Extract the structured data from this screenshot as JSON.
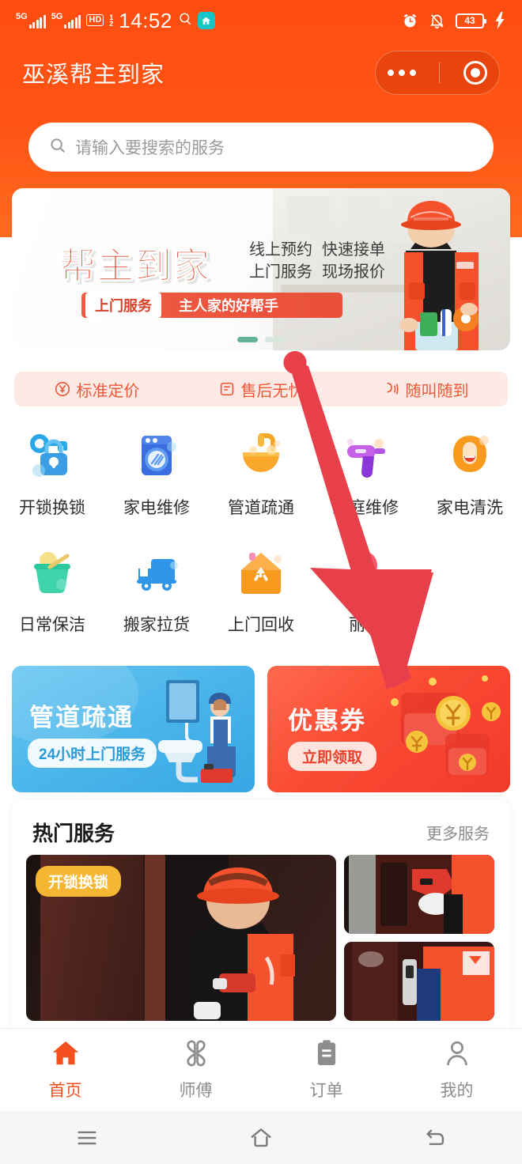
{
  "status_bar": {
    "network_1": "5G",
    "network_2": "5G",
    "hd": "HD",
    "sim_top": "1",
    "sim_bottom": "2",
    "time": "14:52",
    "message_icon": "message-icon",
    "home_chip_icon": "home-chip-icon",
    "alarm_icon": "alarm-icon",
    "mute_icon": "bell-muted-icon",
    "battery_level": "43",
    "charging_icon": "charging-bolt-icon"
  },
  "header": {
    "title": "巫溪帮主到家",
    "capsule": {
      "more_icon": "more-dots-icon",
      "target_icon": "target-circle-icon"
    }
  },
  "search": {
    "icon": "search-icon",
    "placeholder": "请输入要搜索的服务",
    "value": ""
  },
  "banner": {
    "title": "帮主到家",
    "sub_line1_a": "线上预约",
    "sub_line1_b": "快速接单",
    "sub_line2_a": "上门服务",
    "sub_line2_b": "现场报价",
    "badge_left": "上门服务",
    "badge_right": "主人家的好帮手",
    "carousel": {
      "total": 2,
      "active_index": 0
    }
  },
  "features": [
    {
      "icon": "yuan-circle-icon",
      "label": "标准定价"
    },
    {
      "icon": "aftersales-icon",
      "label": "售后无忧"
    },
    {
      "icon": "phone-call-icon",
      "label": "随叫随到"
    }
  ],
  "services": {
    "row1": [
      {
        "icon": "lock-key-icon",
        "label": "开锁换锁"
      },
      {
        "icon": "washing-machine-icon",
        "label": "家电维修"
      },
      {
        "icon": "faucet-sink-icon",
        "label": "管道疏通"
      },
      {
        "icon": "drill-icon",
        "label": "家庭维修"
      },
      {
        "icon": "hair-person-icon",
        "label": "家电清洗"
      }
    ],
    "row2": [
      {
        "icon": "cleaning-bucket-icon",
        "label": "日常保洁"
      },
      {
        "icon": "truck-icon",
        "label": "搬家拉货"
      },
      {
        "icon": "recycle-house-icon",
        "label": "上门回收"
      },
      {
        "icon": "beauty-icon",
        "label": "丽人"
      }
    ]
  },
  "promos": {
    "blue": {
      "title": "管道疏通",
      "pill": "24小时上门服务",
      "illustration": "plumber-sink-icon"
    },
    "red": {
      "title": "优惠券",
      "pill": "立即领取",
      "illustration": "red-envelope-coins-icon"
    }
  },
  "hot_services": {
    "title": "热门服务",
    "more_label": "更多服务",
    "featured_badge": "开锁换锁",
    "featured_image": "locksmith-working-photo",
    "thumbnails": [
      "lock-drill-closeup-photo",
      "smart-lock-install-photo"
    ]
  },
  "annotation": {
    "arrow_icon": "red-arrow-pointer",
    "color": "#e8404a"
  },
  "tabbar": [
    {
      "icon": "home-icon",
      "label": "首页",
      "active": true
    },
    {
      "icon": "clover-icon",
      "label": "师傅",
      "active": false
    },
    {
      "icon": "clipboard-icon",
      "label": "订单",
      "active": false
    },
    {
      "icon": "person-icon",
      "label": "我的",
      "active": false
    }
  ],
  "android_nav": [
    {
      "icon": "recents-icon"
    },
    {
      "icon": "home-outline-icon"
    },
    {
      "icon": "back-icon"
    }
  ],
  "colors": {
    "brand_orange": "#ff5014",
    "accent_red": "#e8412a",
    "blue_card": "#4ab5ea",
    "active_tab": "#f4511e",
    "badge_yellow": "#f5b731"
  }
}
